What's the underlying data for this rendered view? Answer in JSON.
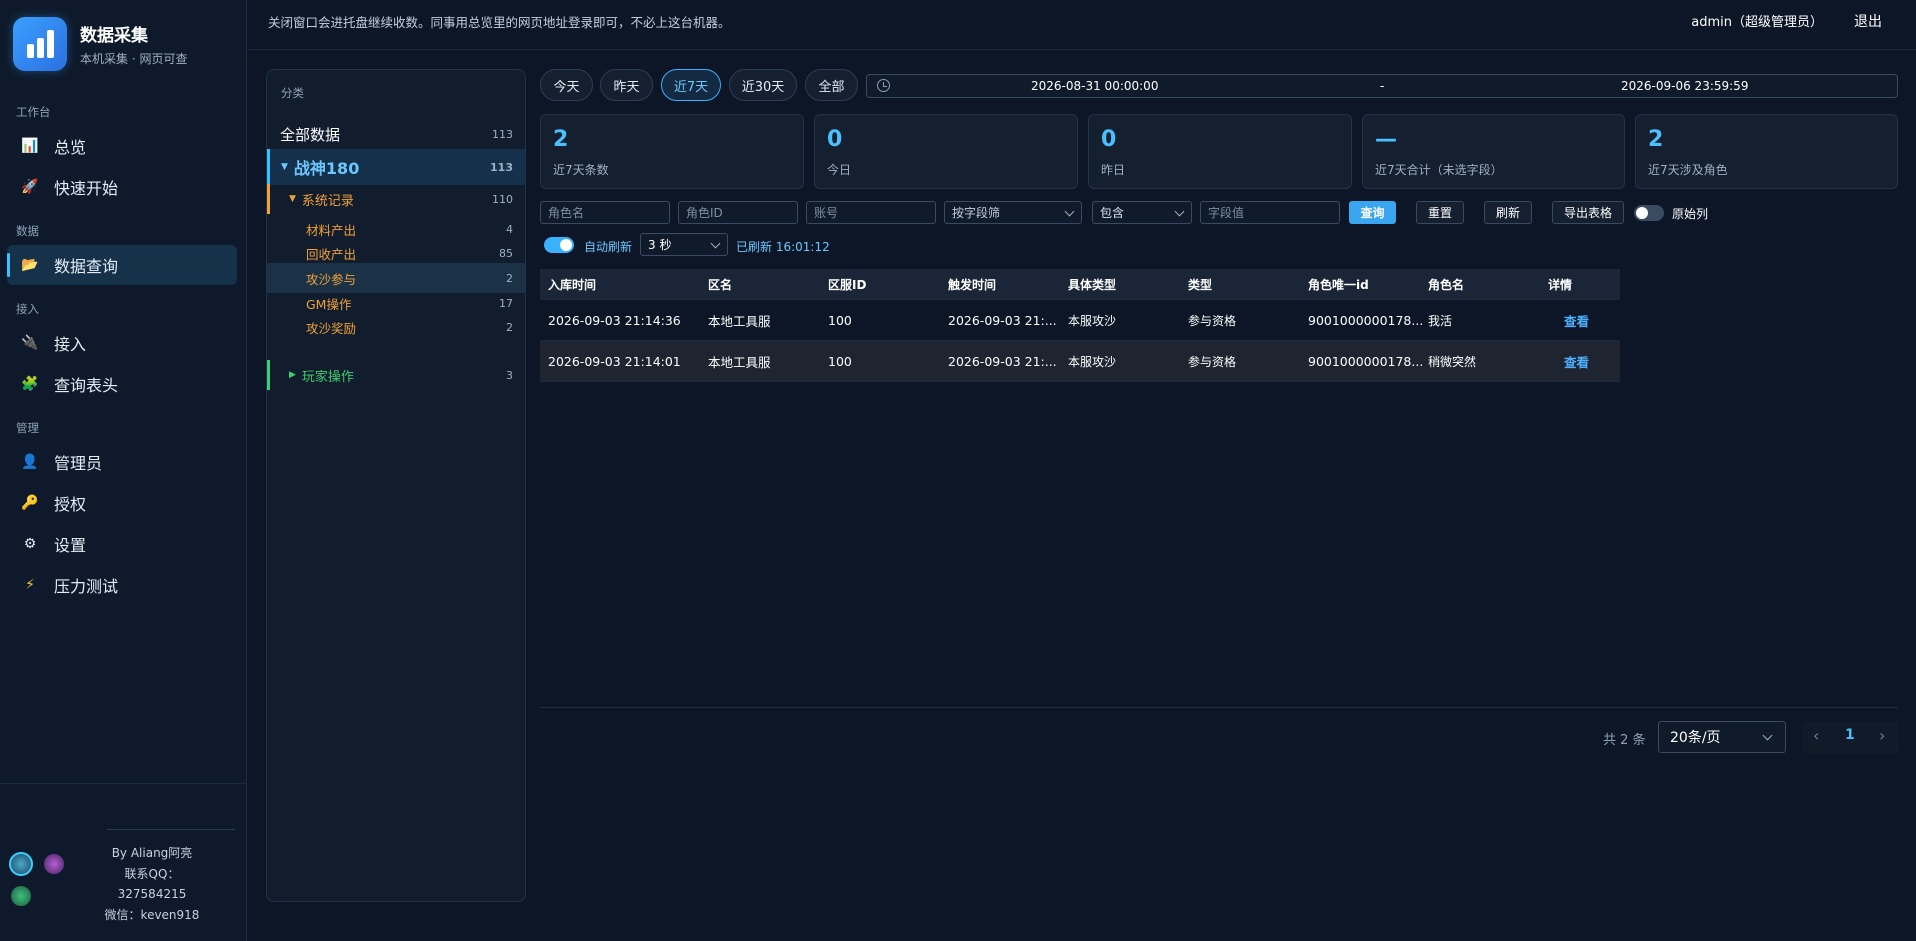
{
  "brand": {
    "title": "数据采集",
    "subtitle": "本机采集 · 网页可查"
  },
  "nav": {
    "sections": [
      "工作台",
      "数据",
      "接入",
      "管理"
    ],
    "items": [
      {
        "label": "总览",
        "icon": "bar-chart-icon"
      },
      {
        "label": "快速开始",
        "icon": "rocket-icon"
      },
      {
        "label": "数据查询",
        "icon": "folder-icon"
      },
      {
        "label": "接入",
        "icon": "plug-icon"
      },
      {
        "label": "查询表头",
        "icon": "puzzle-icon"
      },
      {
        "label": "管理员",
        "icon": "admin-icon"
      },
      {
        "label": "授权",
        "icon": "key-icon"
      },
      {
        "label": "设置",
        "icon": "gear-icon"
      },
      {
        "label": "压力测试",
        "icon": "lightning-icon"
      }
    ],
    "active": "数据查询"
  },
  "footer": {
    "by": "By Aliang阿亮",
    "qq_label": "联系QQ：",
    "qq": "327584215",
    "wechat": "微信：keven918"
  },
  "topbar": {
    "notice": "关闭窗口会进托盘继续收数。同事用总览里的网页地址登录即可，不必上这台机器。",
    "user": "admin（超级管理员）",
    "logout": "退出"
  },
  "categories": {
    "header": "分类",
    "all": {
      "label": "全部数据",
      "count": "113"
    },
    "game": {
      "label": "战神180",
      "count": "113"
    },
    "system": {
      "label": "系统记录",
      "count": "110"
    },
    "subs": [
      {
        "label": "材料产出",
        "count": "4"
      },
      {
        "label": "回收产出",
        "count": "85"
      },
      {
        "label": "攻沙参与",
        "count": "2"
      },
      {
        "label": "GM操作",
        "count": "17"
      },
      {
        "label": "攻沙奖励",
        "count": "2"
      }
    ],
    "player": {
      "label": "玩家操作",
      "count": "3"
    }
  },
  "quick_ranges": [
    "今天",
    "昨天",
    "近7天",
    "近30天",
    "全部"
  ],
  "active_range": "近7天",
  "date_range": {
    "start": "2026-08-31 00:00:00",
    "separator": "-",
    "end": "2026-09-06 23:59:59"
  },
  "stats": [
    {
      "value": "2",
      "label": "近7天条数"
    },
    {
      "value": "0",
      "label": "今日"
    },
    {
      "value": "0",
      "label": "昨日"
    },
    {
      "value": "—",
      "label": "近7天合计（未选字段）"
    },
    {
      "value": "2",
      "label": "近7天涉及角色"
    }
  ],
  "filters": {
    "role_name_placeholder": "角色名",
    "role_id_placeholder": "角色ID",
    "account_placeholder": "账号",
    "field_select": "按字段筛",
    "match_select": "包含",
    "value_placeholder": "字段值",
    "query": "查询",
    "reset": "重置",
    "refresh": "刷新",
    "export": "导出表格",
    "raw_toggle_label": "原始列",
    "raw_toggle_on": false
  },
  "auto_refresh": {
    "label": "自动刷新",
    "on": true,
    "interval": "3 秒",
    "status": "已刷新 16:01:12"
  },
  "table": {
    "headers": [
      "入库时间",
      "区名",
      "区服ID",
      "触发时间",
      "具体类型",
      "类型",
      "角色唯一id",
      "角色名",
      "详情"
    ],
    "rows": [
      [
        "2026-09-03 21:14:36",
        "本地工具服",
        "100",
        "2026-09-03 21:...",
        "本服攻沙",
        "参与资格",
        "9001000000178...",
        "我活",
        "查看"
      ],
      [
        "2026-09-03 21:14:01",
        "本地工具服",
        "100",
        "2026-09-03 21:...",
        "本服攻沙",
        "参与资格",
        "9001000000178...",
        "稍微突然",
        "查看"
      ]
    ]
  },
  "pagination": {
    "total": "共 2 条",
    "page_size": "20条/页",
    "current_page": "1",
    "prev": "‹",
    "next": "›"
  },
  "colors": {
    "accent": "#3ab0ff",
    "orange": "#f0a23a",
    "green": "#3ccf6f",
    "bg": "#0c1626"
  }
}
